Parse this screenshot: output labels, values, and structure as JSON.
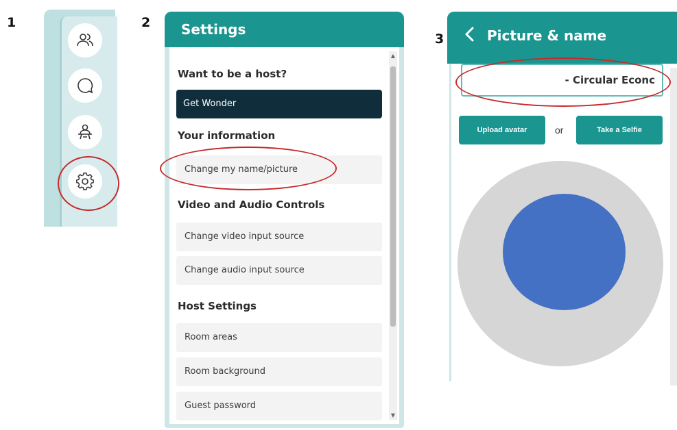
{
  "steps": {
    "one": "1",
    "two": "2",
    "three": "3"
  },
  "sidebar": {
    "buttons": [
      {
        "icon": "people-icon"
      },
      {
        "icon": "chat-icon"
      },
      {
        "icon": "host-icon"
      },
      {
        "icon": "gear-icon"
      }
    ]
  },
  "settings": {
    "title": "Settings",
    "want_host": "Want to be a host?",
    "get_wonder": "Get Wonder",
    "your_info": "Your information",
    "change_name": "Change my name/picture",
    "av_controls": "Video and Audio Controls",
    "change_video": "Change video input source",
    "change_audio": "Change audio input source",
    "host_settings": "Host Settings",
    "room_areas": "Room areas",
    "room_background": "Room background",
    "guest_password": "Guest password"
  },
  "picture": {
    "title": "Picture & name",
    "name_value": "- Circular Econc",
    "upload_avatar": "Upload avatar",
    "or": "or",
    "take_selfie": "Take a Selfie"
  },
  "colors": {
    "teal": "#1b9590",
    "dark": "#0f2d3a",
    "highlight": "#c52b2b",
    "avatar_dot": "#4571c4"
  }
}
